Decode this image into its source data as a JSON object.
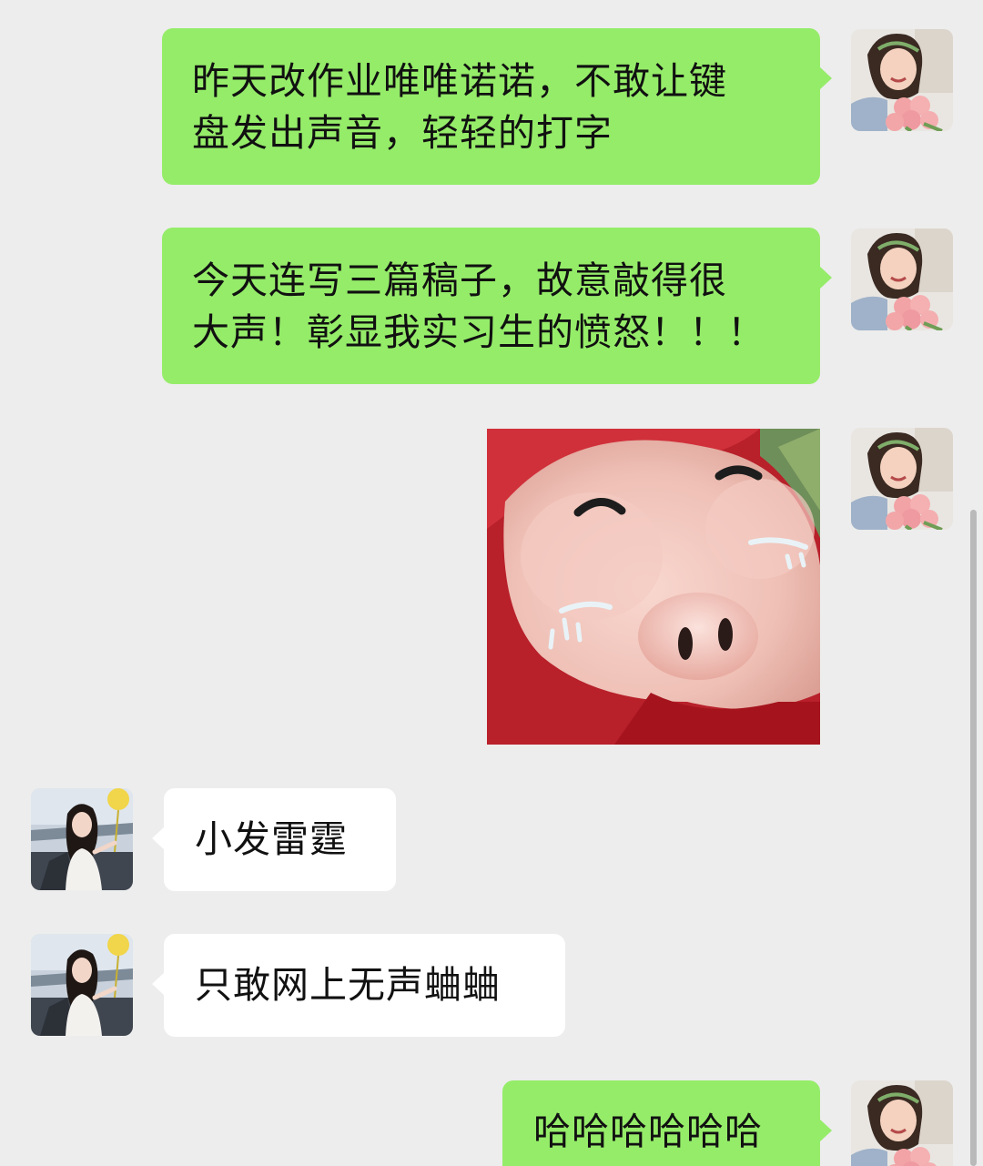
{
  "conversation": {
    "messages": [
      {
        "id": "m1",
        "side": "right",
        "type": "text",
        "text": "昨天改作业唯唯诺诺，不敢让键\n盘发出声音，轻轻的打字"
      },
      {
        "id": "m2",
        "side": "right",
        "type": "text",
        "text": "今天连写三篇稿子，故意敲得很\n大声！彰显我实习生的愤怒！！！"
      },
      {
        "id": "m3",
        "side": "right",
        "type": "sticker",
        "sticker": "crying-pig-sticker"
      },
      {
        "id": "m4",
        "side": "left",
        "type": "text",
        "text": "小发雷霆"
      },
      {
        "id": "m5",
        "side": "left",
        "type": "text",
        "text": "只敢网上无声蛐蛐"
      },
      {
        "id": "m6",
        "side": "right",
        "type": "text",
        "text": "哈哈哈哈哈哈"
      }
    ]
  },
  "colors": {
    "background": "#ededed",
    "self_bubble": "#95ec69",
    "other_bubble": "#ffffff"
  }
}
